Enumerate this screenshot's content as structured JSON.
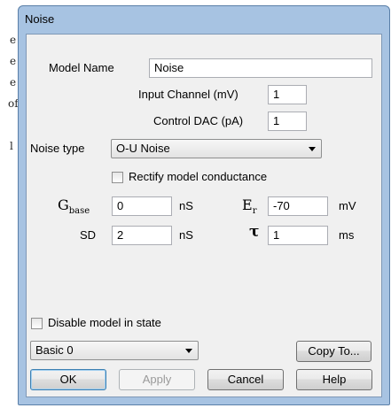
{
  "background": {
    "fragments": [
      "e",
      "e",
      "e",
      "of",
      "l"
    ]
  },
  "window": {
    "title": "Noise"
  },
  "form": {
    "model_name_label": "Model Name",
    "model_name_value": "Noise",
    "input_channel_label": "Input Channel (mV)",
    "input_channel_value": "1",
    "control_dac_label": "Control DAC (pA)",
    "control_dac_value": "1",
    "noise_type_label": "Noise type",
    "noise_type_value": "O-U Noise",
    "rectify_label": "Rectify model conductance",
    "rectify_checked": false,
    "gbase_symbol": "G",
    "gbase_subscript": "base",
    "gbase_value": "0",
    "gbase_unit": "nS",
    "er_symbol": "E",
    "er_subscript": "r",
    "er_value": "-70",
    "er_unit": "mV",
    "sd_label": "SD",
    "sd_value": "2",
    "sd_unit": "nS",
    "tau_symbol": "τ",
    "tau_value": "1",
    "tau_unit": "ms"
  },
  "footer": {
    "disable_label": "Disable model in state",
    "disable_checked": false,
    "state_value": "Basic 0",
    "copy_to_label": "Copy To...",
    "ok_label": "OK",
    "apply_label": "Apply",
    "cancel_label": "Cancel",
    "help_label": "Help"
  }
}
